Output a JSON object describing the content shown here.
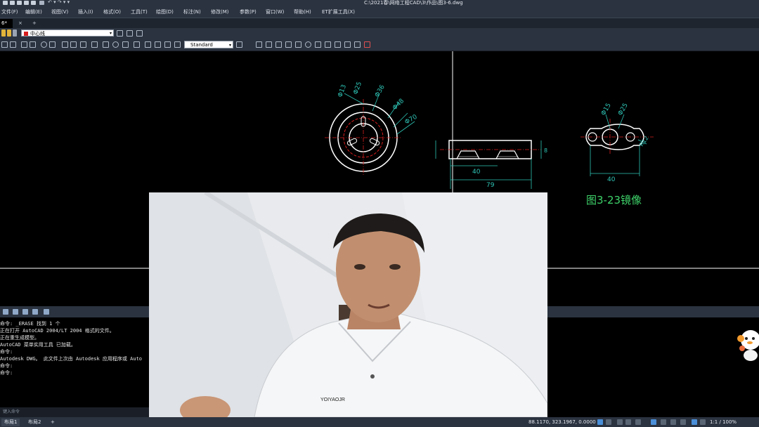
{
  "window": {
    "title": "C:\\2021春\\网络工程CAD\\3\\作品\\图3-6.dwg"
  },
  "menu": [
    "文件(F)",
    "编辑(E)",
    "视图(V)",
    "插入(I)",
    "格式(O)",
    "工具(T)",
    "绘图(D)",
    "标注(N)",
    "修改(M)",
    "参数(P)",
    "窗口(W)",
    "帮助(H)",
    "ET扩展工具(X)"
  ],
  "tabs": {
    "current": "6*",
    "add": "+"
  },
  "layer": {
    "name": "中心线",
    "color": "#d81e1e"
  },
  "dimension": {
    "style": "Standard"
  },
  "drawing": {
    "dims_left": [
      "Φ13",
      "Φ25",
      "Φ36",
      "Φ48",
      "Φ70"
    ],
    "dims_mid": [
      "40",
      "79",
      "8"
    ],
    "dims_right": [
      "Φ15",
      "Φ25",
      "R12",
      "40"
    ],
    "caption": "图3-23镜像"
  },
  "command_log": [
    "命令: _ERASE 找到 1 个",
    "正在打开 AutoCAD 2004/LT 2004 格式的文件。",
    "正在重生成模型。",
    "AutoCAD 菜单实用工具 已加载。",
    "命令:",
    "Autodesk DWG。 此文件上次由 Autodesk 应用程序或 Auto",
    "命令:",
    "命令:"
  ],
  "command_prompt": "键入命令",
  "layout_tabs": [
    "布局1",
    "布局2",
    "+"
  ],
  "status": {
    "coords": "88.1170, 323.1967, 0.0000",
    "scale": "1:1 / 100%"
  },
  "webcam": {
    "shirt_logo": "YOIYAOJR"
  },
  "colors": {
    "ui_dark": "#2b3340",
    "drawing_bg": "#000000",
    "geometry": "#ffffff",
    "centerline": "#d81e1e",
    "dimension": "#2ec4b6",
    "caption": "#3ed36a"
  }
}
